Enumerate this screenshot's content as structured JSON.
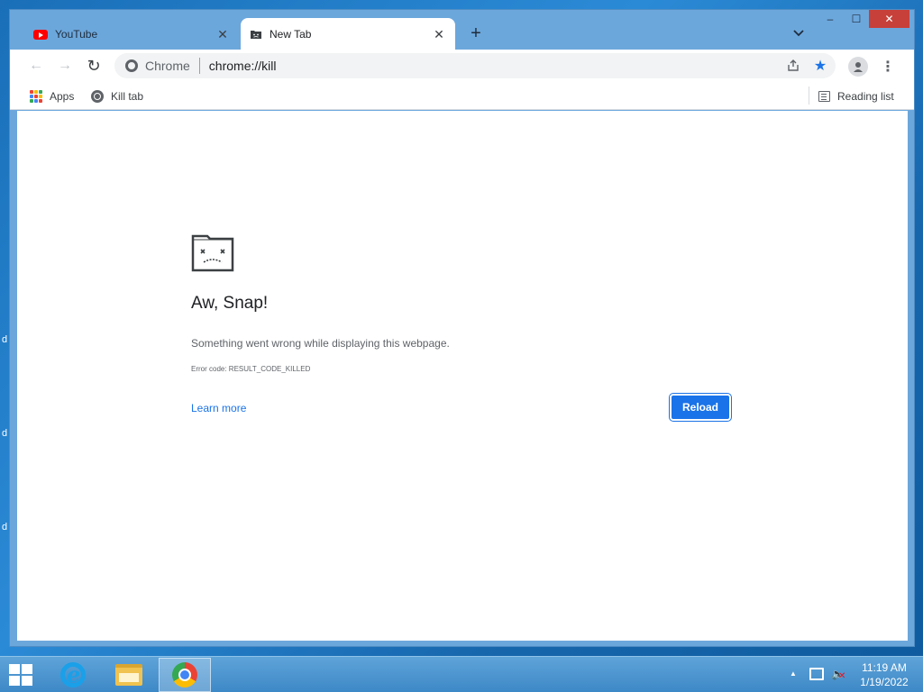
{
  "desktop": {
    "edge_letters": [
      "d",
      "d",
      "d"
    ]
  },
  "window": {
    "tabs": [
      {
        "title": "YouTube",
        "icon": "youtube-icon",
        "active": false
      },
      {
        "title": "New Tab",
        "icon": "sad-tab-icon",
        "active": true
      }
    ],
    "controls": {
      "minimize": "–",
      "maximize": "☐",
      "close": "✕"
    }
  },
  "toolbar": {
    "back": "←",
    "forward": "→",
    "reload": "↻",
    "omnibox": {
      "chip": "Chrome",
      "url": "chrome://kill"
    }
  },
  "bookmarks": {
    "items": [
      {
        "label": "Apps",
        "icon": "apps-grid-icon"
      },
      {
        "label": "Kill tab",
        "icon": "globe-icon"
      }
    ],
    "reading_list": "Reading list"
  },
  "page": {
    "title": "Aw, Snap!",
    "message": "Something went wrong while displaying this webpage.",
    "error_code": "Error code: RESULT_CODE_KILLED",
    "learn_more": "Learn more",
    "reload": "Reload"
  },
  "taskbar": {
    "apps": [
      {
        "name": "Internet Explorer",
        "icon": "ie-icon",
        "active": false
      },
      {
        "name": "File Explorer",
        "icon": "folder-icon",
        "active": false
      },
      {
        "name": "Google Chrome",
        "icon": "chrome-icon",
        "active": true
      }
    ],
    "clock": {
      "time": "11:19 AM",
      "date": "1/19/2022"
    }
  },
  "colors": {
    "accent": "#1a73e8",
    "titlebar": "#6ca7dc",
    "close_button": "#c7403a",
    "taskbar": "#3d88c7"
  }
}
